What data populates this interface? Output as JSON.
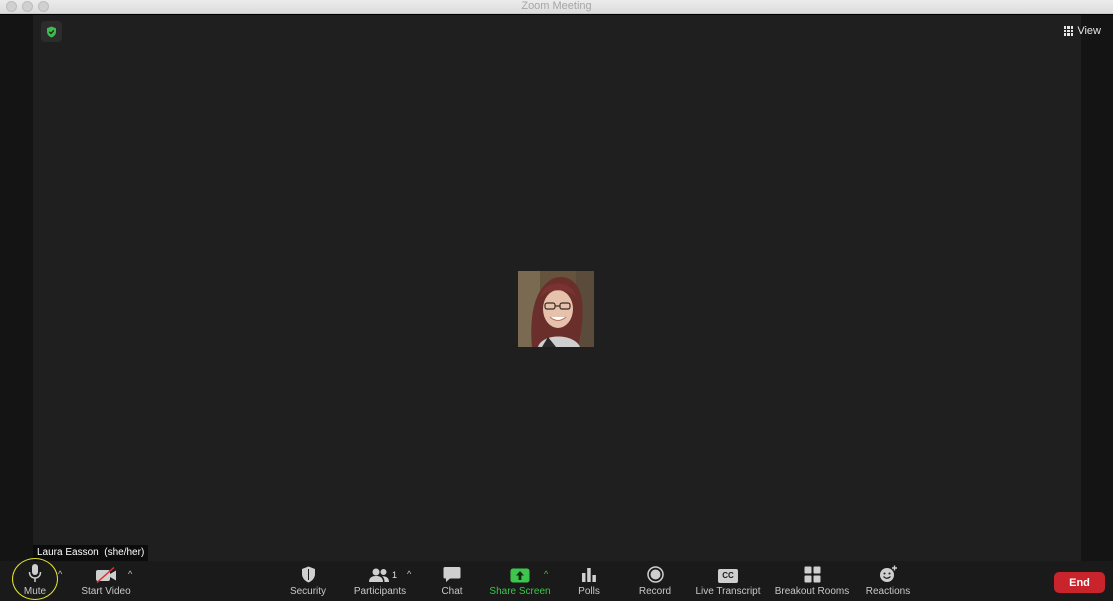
{
  "window": {
    "title": "Zoom Meeting"
  },
  "header": {
    "view_label": "View"
  },
  "participant": {
    "name_tag": "Laura Easson  (she/her)"
  },
  "toolbar": {
    "mute_label": "Mute",
    "start_video_label": "Start Video",
    "security_label": "Security",
    "participants_label": "Participants",
    "participants_count": "1",
    "chat_label": "Chat",
    "share_screen_label": "Share Screen",
    "polls_label": "Polls",
    "record_label": "Record",
    "live_transcript_label": "Live Transcript",
    "live_transcript_icon_text": "CC",
    "breakout_rooms_label": "Breakout Rooms",
    "reactions_label": "Reactions",
    "end_label": "End"
  },
  "colors": {
    "share_green": "#3ec54d",
    "end_red": "#c9232b",
    "security_shield_green": "#3fb950",
    "highlight_ring": "#e5e530"
  }
}
